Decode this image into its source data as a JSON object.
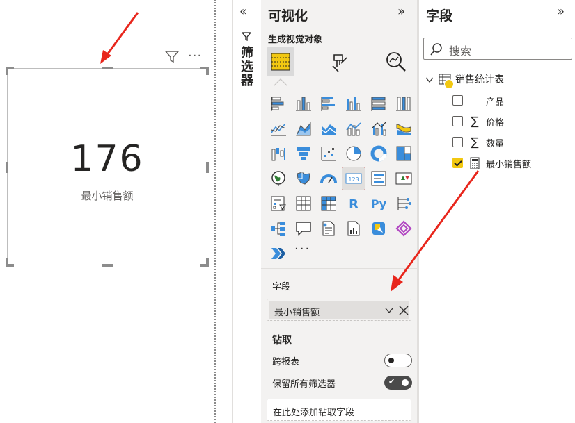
{
  "canvas": {
    "card": {
      "value": "176",
      "label": "最小销售额"
    },
    "card_header_icons": [
      "filter-icon",
      "more-options-icon"
    ]
  },
  "filters_pane": {
    "collapse_glyph": "«",
    "label": "筛选器"
  },
  "visualizations_pane": {
    "title": "可视化",
    "expand_glyph": "»",
    "subtitle": "生成视觉对象",
    "tabs": [
      "build-visual",
      "format-visual",
      "analytics"
    ],
    "more_glyph": "···",
    "fields_well": {
      "label": "字段",
      "value": "最小销售额"
    },
    "drill": {
      "title": "钻取",
      "cross_report_label": "跨报表",
      "cross_report_on": false,
      "keep_filters_label": "保留所有筛选器",
      "keep_filters_on": true,
      "add_placeholder": "在此处添加钻取字段"
    }
  },
  "fields_pane": {
    "title": "字段",
    "expand_glyph": "»",
    "search_placeholder": "搜索",
    "table": {
      "name": "销售统计表",
      "fields": [
        {
          "name": "产品",
          "type": "",
          "checked": false
        },
        {
          "name": "价格",
          "type": "∑",
          "checked": false
        },
        {
          "name": "数量",
          "type": "∑",
          "checked": false
        },
        {
          "name": "最小销售额",
          "type": "calc",
          "checked": true
        }
      ]
    }
  },
  "colors": {
    "accent_yellow": "#f2c811",
    "blue": "#3a8ddb",
    "annotation_red": "#e8261c"
  }
}
